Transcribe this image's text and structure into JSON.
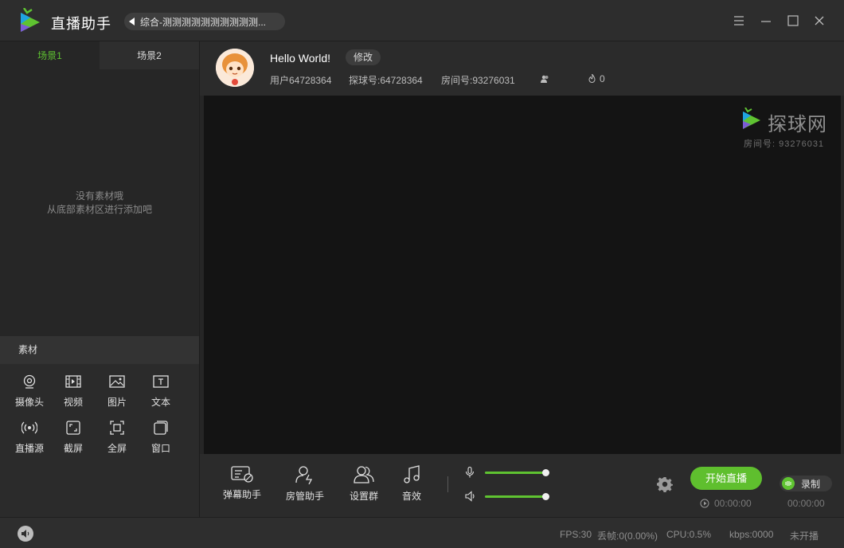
{
  "app": {
    "title": "直播助手",
    "channel": "综合-测测测测测测测测测测..."
  },
  "scenes": {
    "tabs": [
      {
        "label": "场景1"
      },
      {
        "label": "场景2"
      }
    ],
    "empty_line1": "没有素材哦",
    "empty_line2": "从底部素材区进行添加吧"
  },
  "materials": {
    "header": "素材",
    "items": [
      {
        "label": "摄像头",
        "icon": "camera-icon"
      },
      {
        "label": "视频",
        "icon": "video-icon"
      },
      {
        "label": "图片",
        "icon": "image-icon"
      },
      {
        "label": "文本",
        "icon": "text-icon"
      },
      {
        "label": "直播源",
        "icon": "broadcast-icon"
      },
      {
        "label": "截屏",
        "icon": "screenshot-icon"
      },
      {
        "label": "全屏",
        "icon": "fullscreen-icon"
      },
      {
        "label": "窗口",
        "icon": "window-icon"
      }
    ]
  },
  "profile": {
    "name": "Hello World!",
    "edit_label": "修改",
    "user": "用户64728364",
    "tanqiu_id": "探球号:64728364",
    "room_id": "房间号:93276031",
    "heat": "0"
  },
  "preview": {
    "watermark_name": "探球网",
    "watermark_room": "房间号: 93276031"
  },
  "controls": {
    "danmu": "弹幕助手",
    "room_admin": "房管助手",
    "group": "设置群",
    "sound": "音效",
    "mic_level": 1.0,
    "speaker_level": 1.0,
    "go_live": "开始直播",
    "live_time": "00:00:00",
    "record_label": "录制",
    "record_time": "00:00:00"
  },
  "status": {
    "fps": "FPS:30",
    "dropped": "丢帧:0(0.00%)",
    "cpu": "CPU:0.5%",
    "kbps": "kbps:0000",
    "state": "未开播"
  },
  "colors": {
    "accent": "#5fc331",
    "background": "#262626",
    "preview": "#141414"
  }
}
